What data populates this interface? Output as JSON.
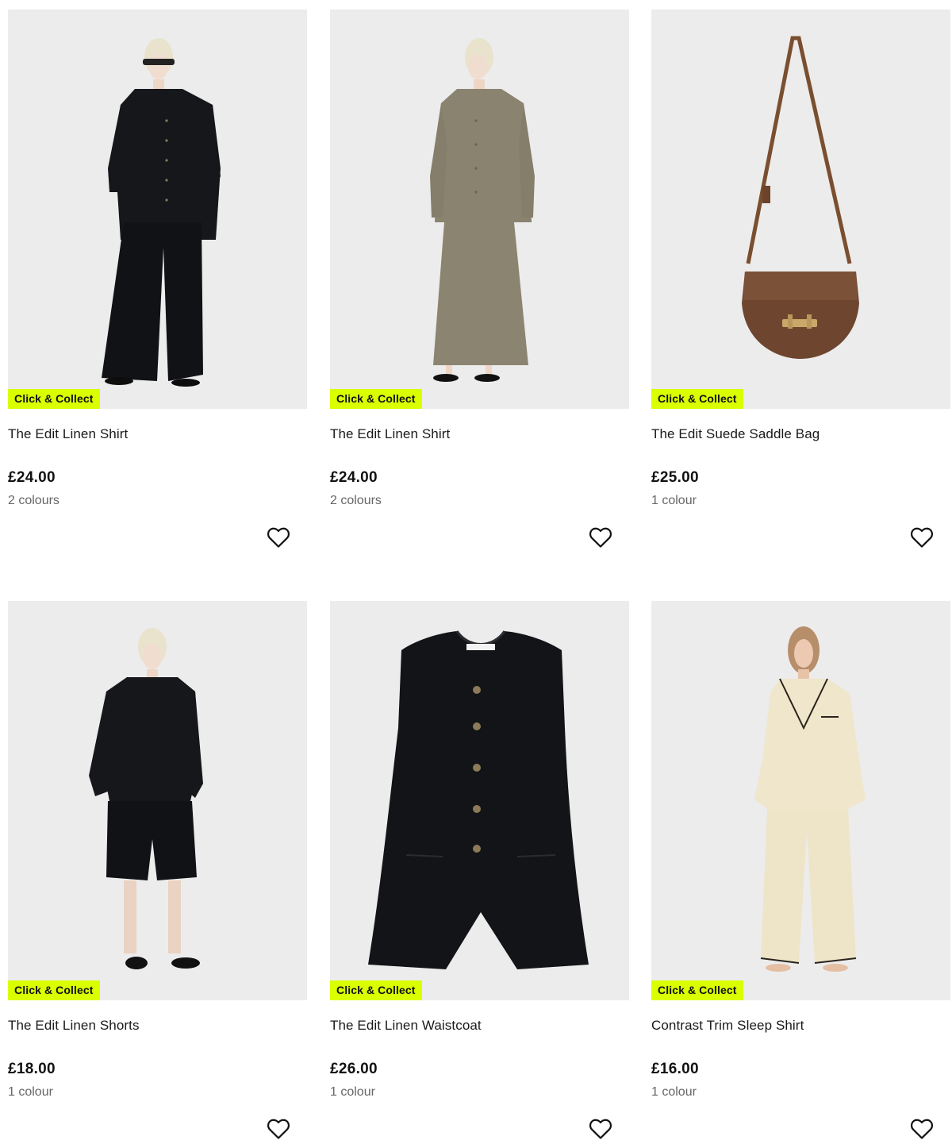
{
  "colors": {
    "badge_bg": "#d9ff00",
    "image_bg": "#ececec"
  },
  "products": [
    {
      "name": "The Edit Linen Shirt",
      "price": "£24.00",
      "colours": "2 colours",
      "badge": "Click & Collect",
      "icon": "heart-icon"
    },
    {
      "name": "The Edit Linen Shirt",
      "price": "£24.00",
      "colours": "2 colours",
      "badge": "Click & Collect",
      "icon": "heart-icon"
    },
    {
      "name": "The Edit Suede Saddle Bag",
      "price": "£25.00",
      "colours": "1 colour",
      "badge": "Click & Collect",
      "icon": "heart-icon"
    },
    {
      "name": "The Edit Linen Shorts",
      "price": "£18.00",
      "colours": "1 colour",
      "badge": "Click & Collect",
      "icon": "heart-icon"
    },
    {
      "name": "The Edit Linen Waistcoat",
      "price": "£26.00",
      "colours": "1 colour",
      "badge": "Click & Collect",
      "icon": "heart-icon"
    },
    {
      "name": "Contrast Trim Sleep Shirt",
      "price": "£16.00",
      "colours": "1 colour",
      "badge": "Click & Collect",
      "icon": "heart-icon"
    }
  ]
}
